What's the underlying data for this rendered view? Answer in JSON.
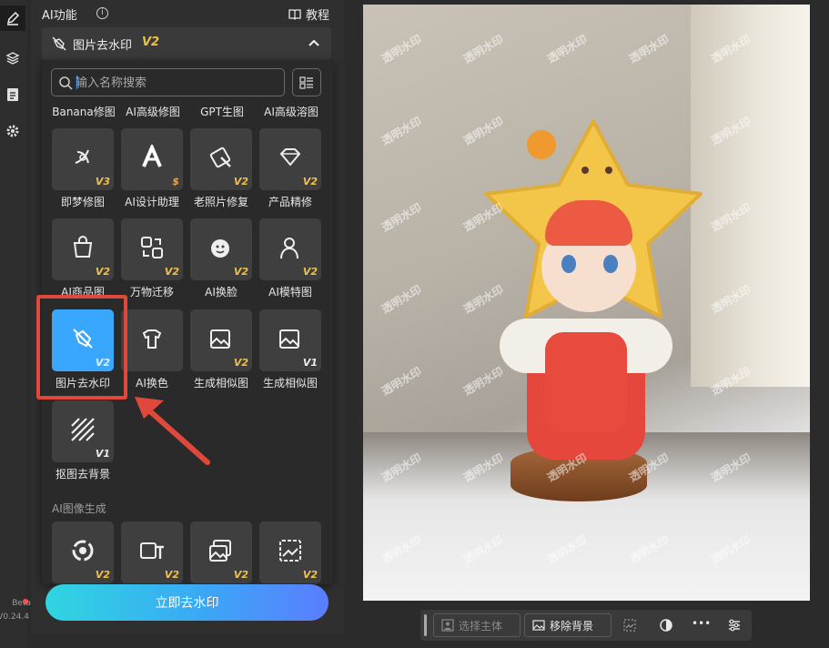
{
  "rail": {
    "beta": "Beta",
    "version": "V0.24.4"
  },
  "panel": {
    "title": "AI功能",
    "info_glyph": "i",
    "tutorial": "教程"
  },
  "feature": {
    "label": "图片去水印",
    "version": "V2"
  },
  "search": {
    "placeholder": "输入名称搜索"
  },
  "top_labels": [
    "Banana修图",
    "AI高级修图",
    "GPT生图",
    "AI高级溶图"
  ],
  "tiles": [
    {
      "label": "即梦修图",
      "badge": "V3",
      "icon": "dreamina-icon"
    },
    {
      "label": "AI设计助理",
      "badge": "$",
      "icon": "ai-design-icon"
    },
    {
      "label": "老照片修复",
      "badge": "V2",
      "icon": "photo-restore-icon"
    },
    {
      "label": "产品精修",
      "badge": "V2",
      "icon": "diamond-icon"
    },
    {
      "label": "AI商品图",
      "badge": "V2",
      "icon": "shopping-bag-icon"
    },
    {
      "label": "万物迁移",
      "badge": "V2",
      "icon": "transfer-icon"
    },
    {
      "label": "AI换脸",
      "badge": "V2",
      "icon": "face-swap-icon"
    },
    {
      "label": "AI模特图",
      "badge": "V2",
      "icon": "model-icon"
    },
    {
      "label": "图片去水印",
      "badge": "V2",
      "icon": "watermark-remove-icon"
    },
    {
      "label": "AI换色",
      "badge": "",
      "icon": "recolor-icon"
    },
    {
      "label": "生成相似图",
      "badge": "V2",
      "icon": "similar-image-icon"
    },
    {
      "label": "生成相似图",
      "badge": "V1",
      "icon": "similar-image-v1-icon"
    },
    {
      "label": "抠图去背景",
      "badge": "V1",
      "icon": "cutout-icon"
    }
  ],
  "section2": {
    "title": "AI图像生成",
    "tiles": [
      {
        "badge": "V2",
        "icon": "swirl-icon"
      },
      {
        "badge": "V2",
        "icon": "image-text-icon"
      },
      {
        "badge": "V2",
        "icon": "image-swap-icon"
      },
      {
        "badge": "V2",
        "icon": "image-frame-icon"
      }
    ]
  },
  "cta": "立即去水印",
  "watermark_text": "透明水印",
  "toolbar": {
    "select_subject": "选择主体",
    "remove_bg": "移除背景",
    "more": "•••"
  },
  "colors": {
    "accent": "#3aa7ff",
    "badge": "#f1c04a",
    "highlight": "#e0483b"
  }
}
